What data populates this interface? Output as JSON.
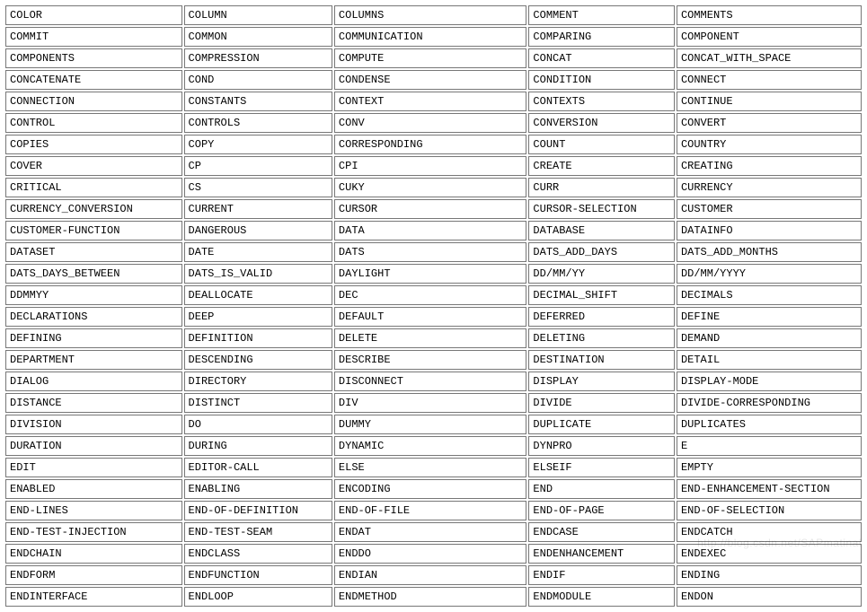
{
  "watermark": "http://blog.csdn.net/SAPmatinal",
  "table": {
    "rows": [
      [
        "COLOR",
        "COLUMN",
        "COLUMNS",
        "COMMENT",
        "COMMENTS"
      ],
      [
        "COMMIT",
        "COMMON",
        "COMMUNICATION",
        "COMPARING",
        "COMPONENT"
      ],
      [
        "COMPONENTS",
        "COMPRESSION",
        "COMPUTE",
        "CONCAT",
        "CONCAT_WITH_SPACE"
      ],
      [
        "CONCATENATE",
        "COND",
        "CONDENSE",
        "CONDITION",
        "CONNECT"
      ],
      [
        "CONNECTION",
        "CONSTANTS",
        "CONTEXT",
        "CONTEXTS",
        "CONTINUE"
      ],
      [
        "CONTROL",
        "CONTROLS",
        "CONV",
        "CONVERSION",
        "CONVERT"
      ],
      [
        "COPIES",
        "COPY",
        "CORRESPONDING",
        "COUNT",
        "COUNTRY"
      ],
      [
        "COVER",
        "CP",
        "CPI",
        "CREATE",
        "CREATING"
      ],
      [
        "CRITICAL",
        "CS",
        "CUKY",
        "CURR",
        "CURRENCY"
      ],
      [
        "CURRENCY_CONVERSION",
        "CURRENT",
        "CURSOR",
        "CURSOR-SELECTION",
        "CUSTOMER"
      ],
      [
        "CUSTOMER-FUNCTION",
        "DANGEROUS",
        "DATA",
        "DATABASE",
        "DATAINFO"
      ],
      [
        "DATASET",
        "DATE",
        "DATS",
        "DATS_ADD_DAYS",
        "DATS_ADD_MONTHS"
      ],
      [
        "DATS_DAYS_BETWEEN",
        "DATS_IS_VALID",
        "DAYLIGHT",
        "DD/MM/YY",
        "DD/MM/YYYY"
      ],
      [
        "DDMMYY",
        "DEALLOCATE",
        "DEC",
        "DECIMAL_SHIFT",
        "DECIMALS"
      ],
      [
        "DECLARATIONS",
        "DEEP",
        "DEFAULT",
        "DEFERRED",
        "DEFINE"
      ],
      [
        "DEFINING",
        "DEFINITION",
        "DELETE",
        "DELETING",
        "DEMAND"
      ],
      [
        "DEPARTMENT",
        "DESCENDING",
        "DESCRIBE",
        "DESTINATION",
        "DETAIL"
      ],
      [
        "DIALOG",
        "DIRECTORY",
        "DISCONNECT",
        "DISPLAY",
        "DISPLAY-MODE"
      ],
      [
        "DISTANCE",
        "DISTINCT",
        "DIV",
        "DIVIDE",
        "DIVIDE-CORRESPONDING"
      ],
      [
        "DIVISION",
        "DO",
        "DUMMY",
        "DUPLICATE",
        "DUPLICATES"
      ],
      [
        "DURATION",
        "DURING",
        "DYNAMIC",
        "DYNPRO",
        "E"
      ],
      [
        "EDIT",
        "EDITOR-CALL",
        "ELSE",
        "ELSEIF",
        "EMPTY"
      ],
      [
        "ENABLED",
        "ENABLING",
        "ENCODING",
        "END",
        "END-ENHANCEMENT-SECTION"
      ],
      [
        "END-LINES",
        "END-OF-DEFINITION",
        "END-OF-FILE",
        "END-OF-PAGE",
        "END-OF-SELECTION"
      ],
      [
        "END-TEST-INJECTION",
        "END-TEST-SEAM",
        "ENDAT",
        "ENDCASE",
        "ENDCATCH"
      ],
      [
        "ENDCHAIN",
        "ENDCLASS",
        "ENDDO",
        "ENDENHANCEMENT",
        "ENDEXEC"
      ],
      [
        "ENDFORM",
        "ENDFUNCTION",
        "ENDIAN",
        "ENDIF",
        "ENDING"
      ],
      [
        "ENDINTERFACE",
        "ENDLOOP",
        "ENDMETHOD",
        "ENDMODULE",
        "ENDON"
      ]
    ]
  }
}
